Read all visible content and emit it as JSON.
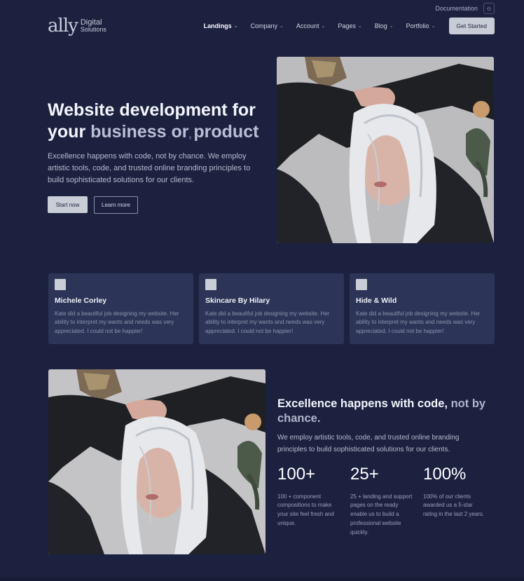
{
  "topbar": {
    "documentation": "Documentation",
    "theme_icon": "sun-icon"
  },
  "header": {
    "logo_mark": "ally",
    "logo_line1": "Digital",
    "logo_line2": "Solutions",
    "nav": [
      {
        "label": "Landings"
      },
      {
        "label": "Company"
      },
      {
        "label": "Account"
      },
      {
        "label": "Pages"
      },
      {
        "label": "Blog"
      },
      {
        "label": "Portfolio"
      }
    ],
    "cta": "Get Started"
  },
  "hero": {
    "title_line1": "Website development for",
    "title_prefix": "your ",
    "title_accent": "business or product",
    "description": "Excellence happens with code, not by chance. We employ artistic tools, code, and trusted online branding principles to build sophisticated solutions for our clients.",
    "primary_cta": "Start now",
    "secondary_cta": "Learn more"
  },
  "testimonials": [
    {
      "name": "Michele Corley",
      "quote": "Kate did a beautiful job designing my website. Her ability to interpret my wants and needs was very appreciated. I could not be happier!"
    },
    {
      "name": "Skincare By Hilary",
      "quote": "Kate did a beautiful job designing my website. Her ability to interpret my wants and needs was very appreciated. I could not be happier!"
    },
    {
      "name": "Hide & Wild",
      "quote": "Kate did a beautiful job designing my website. Her ability to interpret my wants and needs was very appreciated. I could not be happier!"
    }
  ],
  "feature": {
    "title_main": "Excellence happens with code, ",
    "title_muted": "not by chance.",
    "description": "We employ artistic tools, code, and trusted online branding principles to build sophisticated solutions for our clients.",
    "stats": [
      {
        "value": "100+",
        "label": "100 + component compositions to make your site feel fresh and unique."
      },
      {
        "value": "25+",
        "label": "25 + landing and support pages on the ready enable us to build a professional website quickly."
      },
      {
        "value": "100%",
        "label": "100% of our clients awarded us a 5-star rating in the last 2 years."
      }
    ]
  },
  "colors": {
    "background": "#1c2140",
    "card": "#2c3558",
    "button": "#c9cdd6"
  }
}
